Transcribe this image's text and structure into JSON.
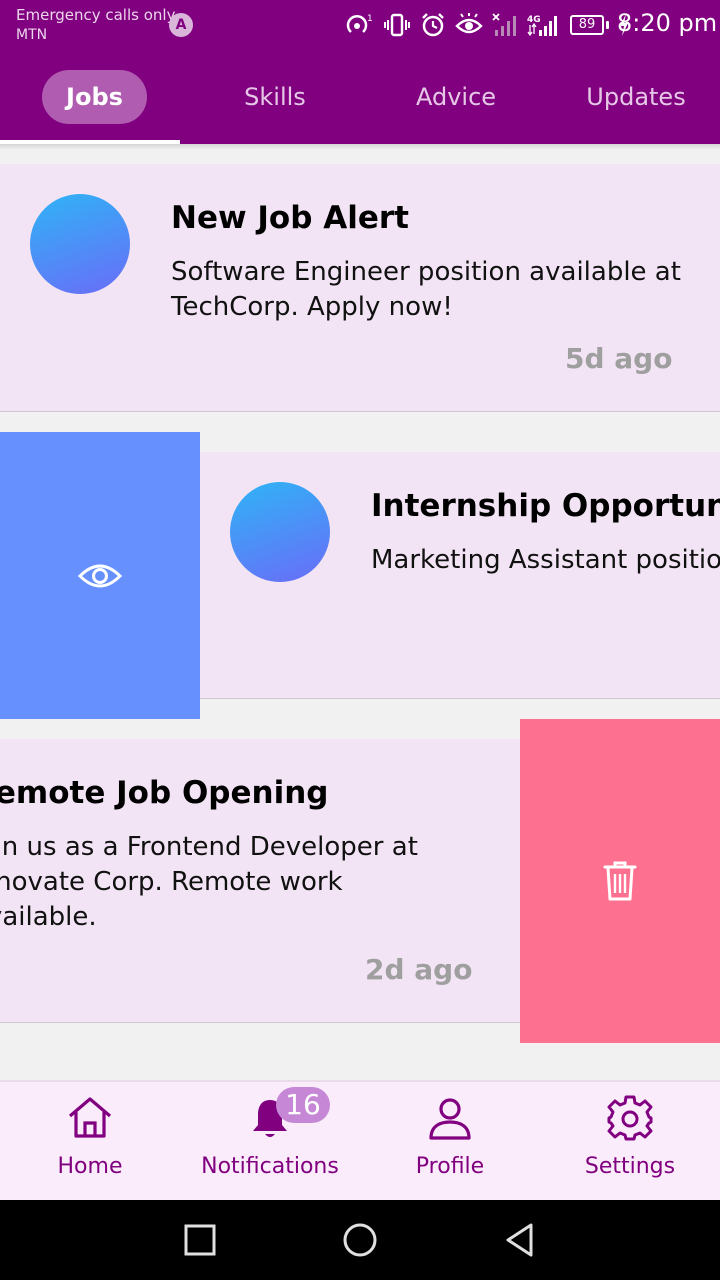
{
  "status_bar": {
    "carrier_line1": "Emergency calls only",
    "carrier_line2": "MTN",
    "app_icon": "A",
    "battery": "89",
    "time": "8:20 pm",
    "icons": [
      "hotspot-icon",
      "vibrate-icon",
      "alarm-icon",
      "eye-comfort-icon",
      "signal-off-icon",
      "4g-signal-icon",
      "battery-icon",
      "charging-icon"
    ]
  },
  "tabs": [
    {
      "label": "Jobs",
      "active": true
    },
    {
      "label": "Skills",
      "active": false
    },
    {
      "label": "Advice",
      "active": false
    },
    {
      "label": "Updates",
      "active": false
    }
  ],
  "cards": [
    {
      "title": "New Job Alert",
      "body": "Software Engineer position available at TechCorp. Apply now!",
      "time": "5d ago"
    },
    {
      "title": "Internship Opportunity",
      "body": "Marketing Assistant position at XYZ Ltd.",
      "time": ""
    },
    {
      "title": "Remote Job Opening",
      "body": "Join us as a Frontend Developer at Innovate Corp. Remote work available.",
      "time": "2d ago"
    }
  ],
  "swipe_actions": {
    "view_icon": "eye-icon",
    "delete_icon": "trash-icon",
    "view_color": "#6690fe",
    "delete_color": "#fe708f"
  },
  "bottom_nav": {
    "items": [
      {
        "label": "Home",
        "icon": "home-icon"
      },
      {
        "label": "Notifications",
        "icon": "bell-icon"
      },
      {
        "label": "Profile",
        "icon": "person-icon"
      },
      {
        "label": "Settings",
        "icon": "gear-icon"
      }
    ],
    "notification_count": "16"
  },
  "system_nav": [
    "recents-icon",
    "home-circle-icon",
    "back-icon"
  ],
  "colors": {
    "primary": "#800080",
    "card_background": "#f2e4f4",
    "nav_background": "#fbecfb"
  }
}
